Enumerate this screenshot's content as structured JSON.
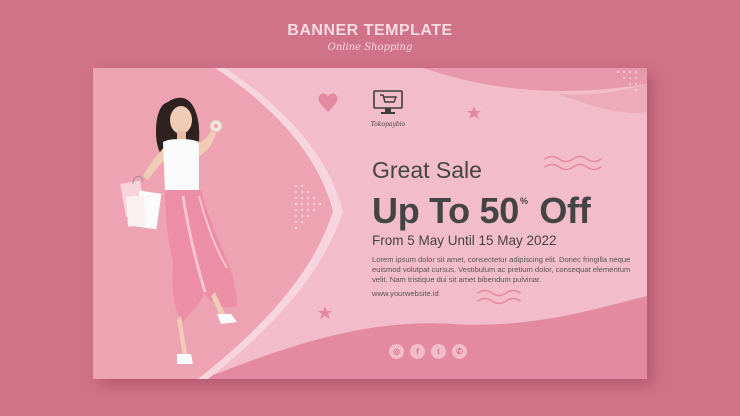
{
  "header": {
    "title": "BANNER TEMPLATE",
    "subtitle": "Online Shopping"
  },
  "banner": {
    "logo": {
      "icon": "cart-monitor-icon",
      "text": "Tokopaybio"
    },
    "headline": "Great Sale",
    "discount": {
      "prefix": "Up To 50",
      "sup": "%",
      "suffix": "Off"
    },
    "dates": "From 5 May Until 15 May 2022",
    "body": "Lorem ipsum dolor sit amet, consectetur adipiscing elit. Donec fringilla neque euismod volutpat cursus. Vestibulum ac pretium dolor, consequat elementum velit. Nam tristique dui sit amet bibendum pulvinar.",
    "website": "www.yourwebsite.id",
    "socials": [
      {
        "icon": "instagram-icon",
        "glyph": "◎"
      },
      {
        "icon": "facebook-icon",
        "glyph": "f"
      },
      {
        "icon": "twitter-icon",
        "glyph": "t"
      },
      {
        "icon": "whatsapp-icon",
        "glyph": "✆"
      }
    ]
  },
  "colors": {
    "page_bg": "#d17388",
    "banner_bg": "#f2bccb",
    "accent_pink": "#e8889f",
    "photo_bg": "#eea3b3",
    "text_dark": "#444444"
  }
}
